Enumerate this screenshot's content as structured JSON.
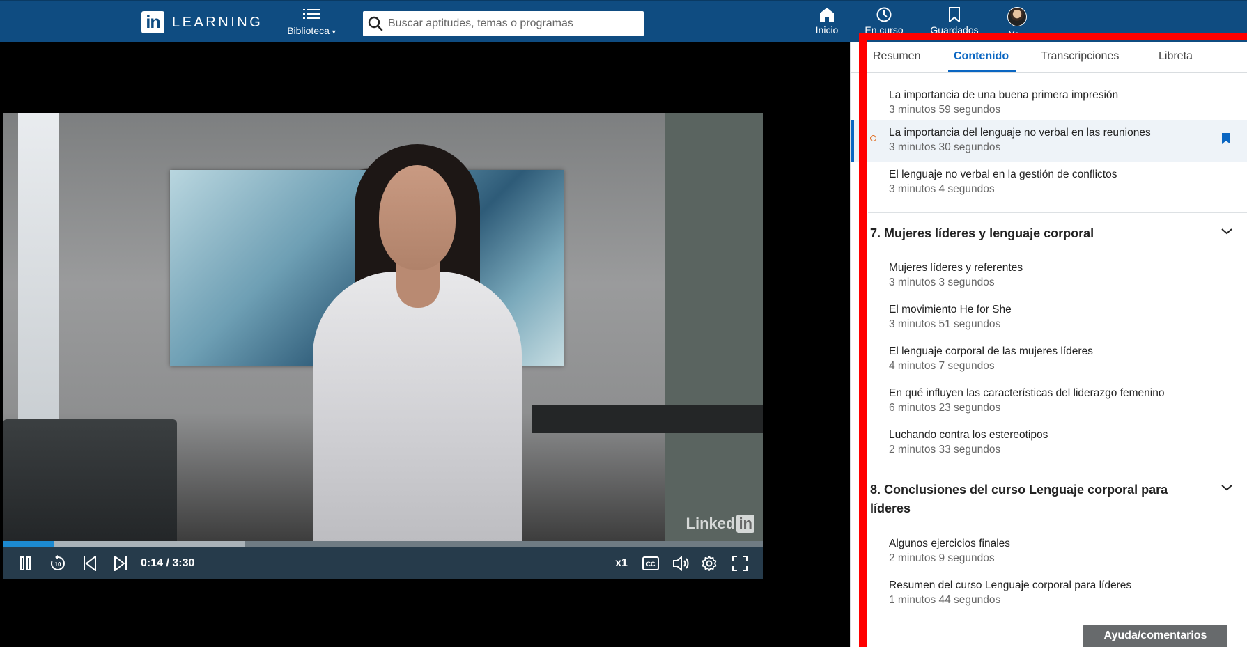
{
  "topnav": {
    "logo_mark": "in",
    "logo_text": "LEARNING",
    "library_label": "Biblioteca",
    "search_placeholder": "Buscar aptitudes, temas o programas",
    "items": [
      {
        "label": "Inicio",
        "icon": "home-icon"
      },
      {
        "label": "En curso",
        "icon": "clock-icon"
      },
      {
        "label": "Guardados",
        "icon": "bookmark-icon"
      },
      {
        "label": "Yo",
        "icon": "avatar"
      }
    ]
  },
  "video": {
    "watermark": "Linked",
    "watermark_in": "in",
    "current_time": "0:14 / 3:30",
    "progress_played": 0.067,
    "progress_buffered": 0.319,
    "speed_label": "x1",
    "cc_label": "CC",
    "rewind_label": "10"
  },
  "panel": {
    "tabs": [
      "Resumen",
      "Contenido",
      "Transcripciones",
      "Libreta"
    ],
    "active_tab": "Contenido",
    "items_top": [
      {
        "title": "La importancia de una buena primera impresión",
        "duration": "3 minutos 59 segundos"
      },
      {
        "title": "La importancia del lenguaje no verbal en las reuniones",
        "duration": "3 minutos 30 segundos",
        "current": true
      },
      {
        "title": "El lenguaje no verbal en la gestión de conflictos",
        "duration": "3 minutos 4 segundos"
      }
    ],
    "section7": {
      "title": "7. Mujeres líderes y lenguaje corporal",
      "items": [
        {
          "title": "Mujeres líderes y referentes",
          "duration": "3 minutos 3 segundos"
        },
        {
          "title": "El movimiento He for She",
          "duration": "3 minutos 51 segundos"
        },
        {
          "title": "El lenguaje corporal de las mujeres líderes",
          "duration": "4 minutos 7 segundos"
        },
        {
          "title": "En qué influyen las características del liderazgo femenino",
          "duration": "6 minutos 23 segundos"
        },
        {
          "title": "Luchando contra los estereotipos",
          "duration": "2 minutos 33 segundos"
        }
      ]
    },
    "section8": {
      "title": "8. Conclusiones del curso Lenguaje corporal para líderes",
      "items": [
        {
          "title": "Algunos ejercicios finales",
          "duration": "2 minutos 9 segundos"
        },
        {
          "title": "Resumen del curso Lenguaje corporal para líderes",
          "duration": "1 minutos 44 segundos"
        }
      ]
    }
  },
  "help_button": "Ayuda/comentarios",
  "colors": {
    "nav_bg": "#0f4c81",
    "accent": "#0a66c2",
    "highlight": "#ff0000",
    "controls_bg": "#263b4b"
  }
}
